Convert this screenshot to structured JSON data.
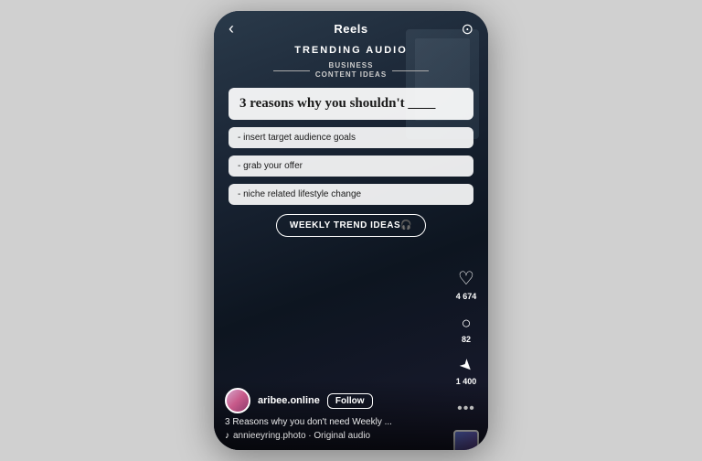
{
  "header": {
    "title": "Reels",
    "back_icon": "‹",
    "camera_icon": "⊙"
  },
  "trending": {
    "label": "TRENDING AUDIO",
    "badge_line1": "BUSINESS",
    "badge_line2": "CONTENT IDEAS"
  },
  "content_cards": {
    "title": "3 reasons why you shouldn't ____",
    "items": [
      "- insert target audience goals",
      "- grab your offer",
      "- niche related lifestyle change"
    ]
  },
  "trend_button": {
    "label": "WEEKLY TREND IDEAS🎧"
  },
  "actions": {
    "like_icon": "♡",
    "like_count": "4 674",
    "comment_icon": "💬",
    "comment_count": "82",
    "share_icon": "⬆",
    "share_count": "1 400",
    "more_icon": "•••"
  },
  "user": {
    "username": "aribee.online",
    "follow_label": "Follow",
    "caption": "3 Reasons why you don't need Weekly ...",
    "audio": "annieeyring.photo · Original audio"
  }
}
